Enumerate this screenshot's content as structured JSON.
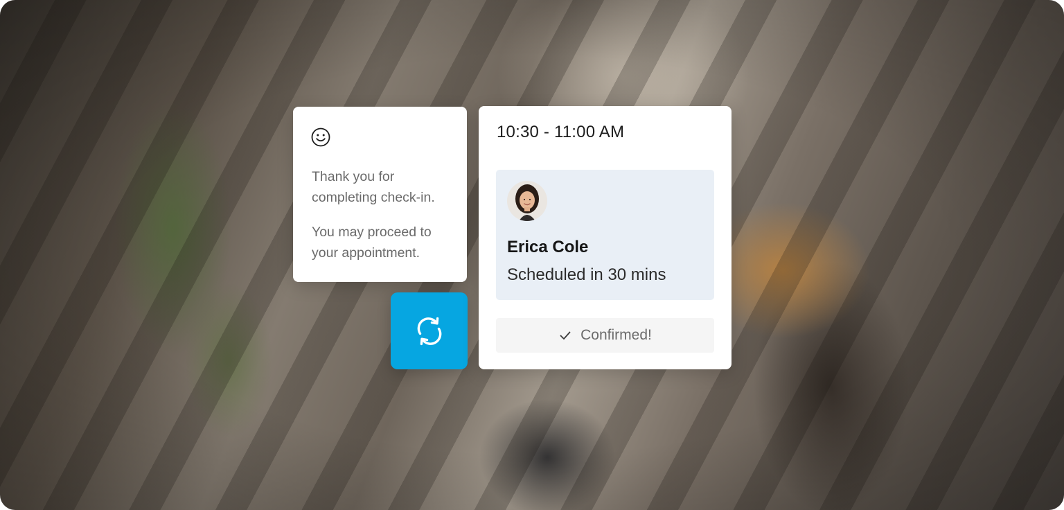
{
  "checkin": {
    "icon": "smiley-icon",
    "message_line1": "Thank you for completing check-in.",
    "message_line2": "You may proceed to your appointment."
  },
  "refresh": {
    "icon": "refresh-icon",
    "color": "#06A6E1"
  },
  "appointment": {
    "time_range": "10:30 - 11:00 AM",
    "person_name": "Erica Cole",
    "status": "Scheduled in 30 mins",
    "confirm_label": "Confirmed!",
    "confirm_icon": "checkmark-icon",
    "panel_color": "#E9EFF6"
  }
}
